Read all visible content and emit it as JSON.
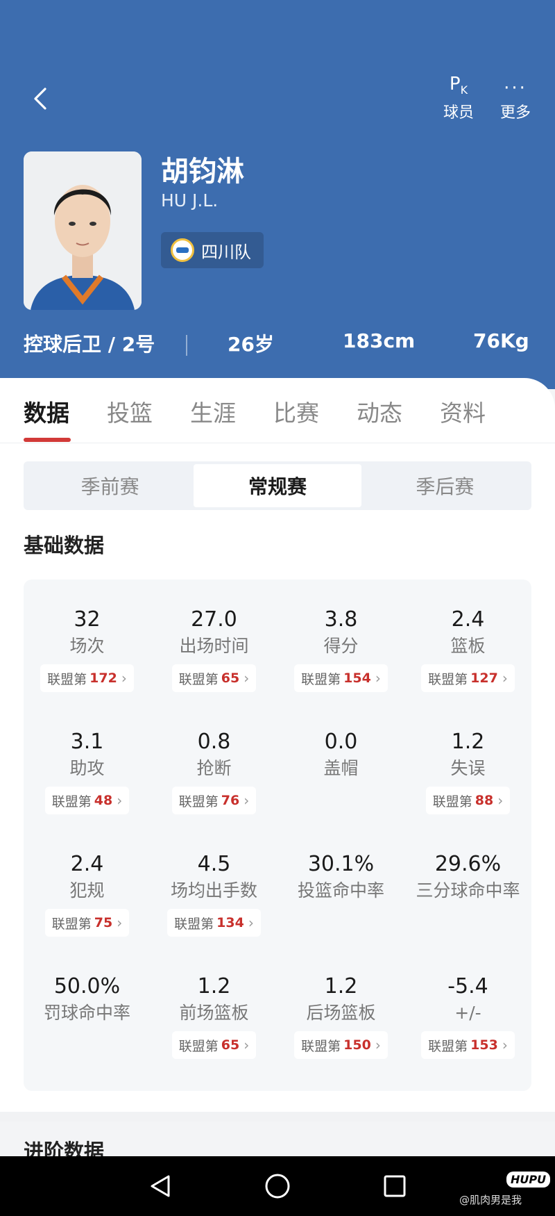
{
  "header": {
    "back_icon": "chevron-left-icon",
    "actions": [
      {
        "icon": "pk-icon",
        "glyph": "P",
        "glyph_sub": "K",
        "label": "球员"
      },
      {
        "icon": "more-dots-icon",
        "glyph": "···",
        "label": "更多"
      }
    ],
    "player": {
      "name": "胡钧淋",
      "english_name": "HU J.L.",
      "team": "四川队",
      "position_number": "控球后卫 / 2号",
      "age": "26岁",
      "height": "183cm",
      "weight": "76Kg"
    },
    "colors": {
      "header_bg": "#3d6daf",
      "accent_red": "#d23a38"
    }
  },
  "tabs": [
    {
      "label": "数据",
      "active": true
    },
    {
      "label": "投篮",
      "active": false
    },
    {
      "label": "生涯",
      "active": false
    },
    {
      "label": "比赛",
      "active": false
    },
    {
      "label": "动态",
      "active": false
    },
    {
      "label": "资料",
      "active": false
    }
  ],
  "season_toggle": [
    {
      "label": "季前赛",
      "active": false
    },
    {
      "label": "常规赛",
      "active": true
    },
    {
      "label": "季后赛",
      "active": false
    }
  ],
  "basic_stats": {
    "title": "基础数据",
    "rank_prefix": "联盟第",
    "items": [
      {
        "value": "32",
        "label": "场次",
        "rank": "172"
      },
      {
        "value": "27.0",
        "label": "出场时间",
        "rank": "65"
      },
      {
        "value": "3.8",
        "label": "得分",
        "rank": "154"
      },
      {
        "value": "2.4",
        "label": "篮板",
        "rank": "127"
      },
      {
        "value": "3.1",
        "label": "助攻",
        "rank": "48"
      },
      {
        "value": "0.8",
        "label": "抢断",
        "rank": "76"
      },
      {
        "value": "0.0",
        "label": "盖帽",
        "rank": null
      },
      {
        "value": "1.2",
        "label": "失误",
        "rank": "88"
      },
      {
        "value": "2.4",
        "label": "犯规",
        "rank": "75"
      },
      {
        "value": "4.5",
        "label": "场均出手数",
        "rank": "134"
      },
      {
        "value": "30.1%",
        "label": "投篮命中率",
        "rank": null
      },
      {
        "value": "29.6%",
        "label": "三分球命中率",
        "rank": null
      },
      {
        "value": "50.0%",
        "label": "罚球命中率",
        "rank": null
      },
      {
        "value": "1.2",
        "label": "前场篮板",
        "rank": "65"
      },
      {
        "value": "1.2",
        "label": "后场篮板",
        "rank": "150"
      },
      {
        "value": "-5.4",
        "label": "+/-",
        "rank": "153"
      }
    ]
  },
  "advanced_stats": {
    "title": "进阶数据"
  },
  "watermark": {
    "logo": "HUPU",
    "text": "@肌肉男是我"
  },
  "navbar": {
    "icons": [
      "nav-back-icon",
      "nav-home-icon",
      "nav-recents-icon"
    ]
  }
}
